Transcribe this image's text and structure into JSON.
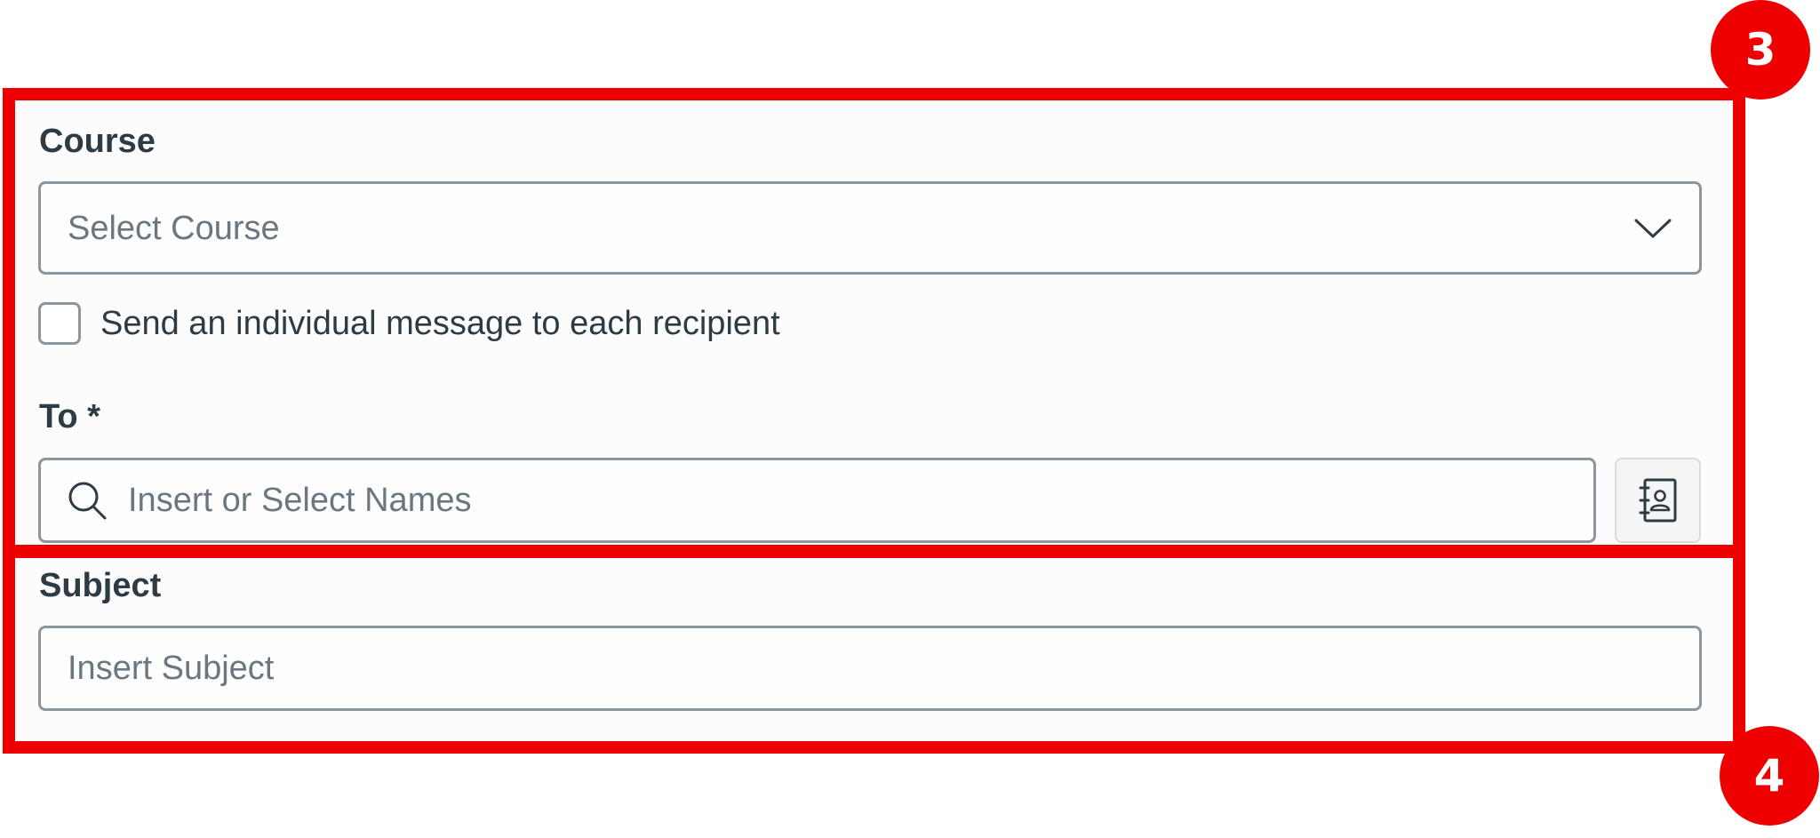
{
  "course": {
    "label": "Course",
    "placeholder": "Select Course",
    "icon": "chevron-down-icon"
  },
  "individual_message": {
    "label": "Send an individual message to each recipient",
    "checked": false
  },
  "to": {
    "label": "To *",
    "placeholder": "Insert or Select Names",
    "search_icon": "search-icon",
    "address_book_icon": "address-book-icon"
  },
  "subject": {
    "label": "Subject",
    "placeholder": "Insert Subject"
  },
  "callouts": [
    {
      "number": "3"
    },
    {
      "number": "4"
    }
  ],
  "colors": {
    "callout_red": "#ef0000",
    "text_dark": "#2d3b45",
    "placeholder_gray": "#6b7780",
    "border_gray": "#8b969e"
  }
}
